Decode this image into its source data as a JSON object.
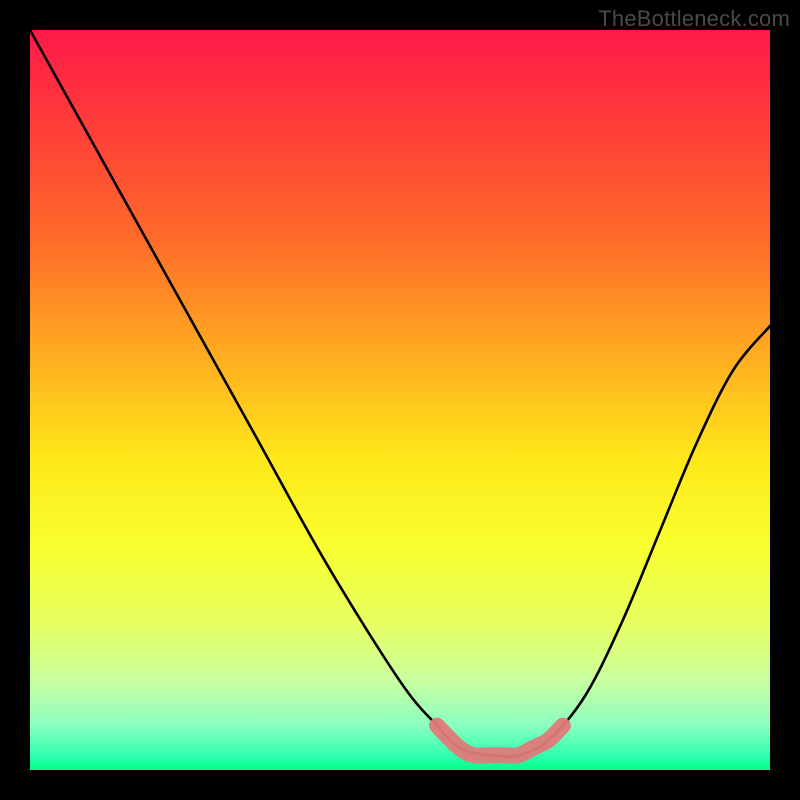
{
  "watermark": "TheBottleneck.com",
  "chart_data": {
    "type": "line",
    "title": "",
    "xlabel": "",
    "ylabel": "",
    "xlim": [
      0,
      100
    ],
    "ylim": [
      0,
      100
    ],
    "grid": false,
    "legend": false,
    "annotations": [],
    "series": [
      {
        "name": "bottleneck-curve",
        "color": "#000000",
        "x": [
          0,
          10,
          20,
          30,
          40,
          50,
          55,
          58,
          62,
          66,
          70,
          75,
          80,
          85,
          90,
          95,
          100
        ],
        "y": [
          100,
          82,
          64,
          46,
          28,
          12,
          6,
          3,
          2,
          2,
          4,
          10,
          20,
          32,
          44,
          54,
          60
        ]
      },
      {
        "name": "optimal-band",
        "color": "#e07a7a",
        "x": [
          55,
          58,
          60,
          62,
          64,
          66,
          68,
          70,
          72
        ],
        "y": [
          6,
          3,
          2,
          2,
          2,
          2,
          3,
          4,
          6
        ]
      }
    ],
    "background_gradient": {
      "top": "#ff1a4a",
      "mid": "#ffe81a",
      "bottom": "#00ff88"
    }
  }
}
